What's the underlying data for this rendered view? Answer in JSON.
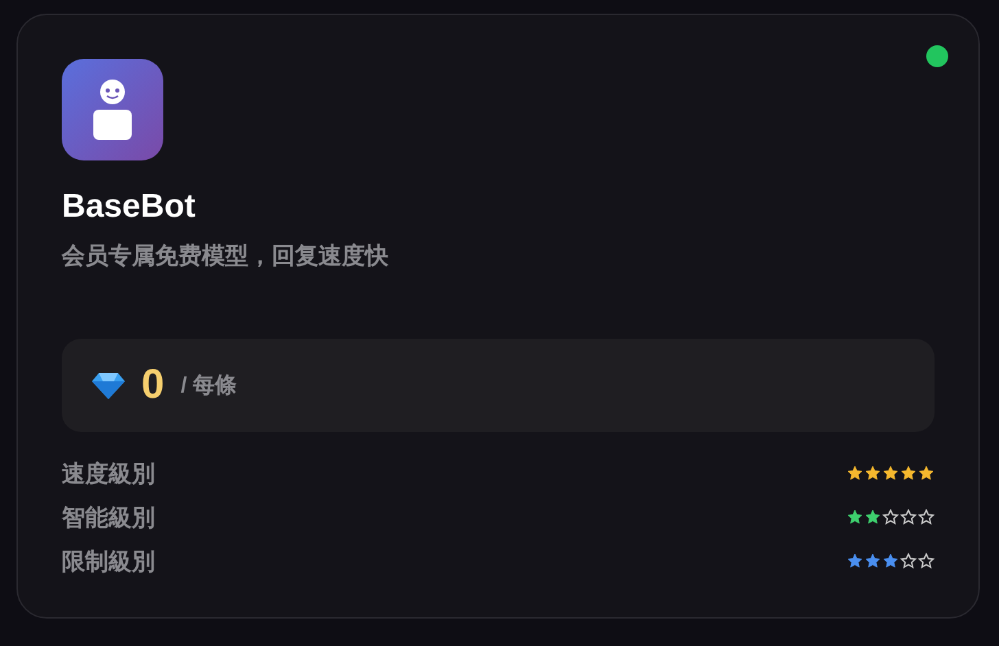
{
  "status": {
    "online": true
  },
  "bot": {
    "name": "BaseBot",
    "description": "会员专属免费模型，回复速度快"
  },
  "price": {
    "amount": "0",
    "unit": "/ 每條"
  },
  "ratings": [
    {
      "label": "速度級別",
      "stars": 5,
      "color": "#f5b82e"
    },
    {
      "label": "智能級別",
      "stars": 2,
      "color": "#3ecf6e"
    },
    {
      "label": "限制級別",
      "stars": 3,
      "color": "#4a8ff0"
    }
  ]
}
